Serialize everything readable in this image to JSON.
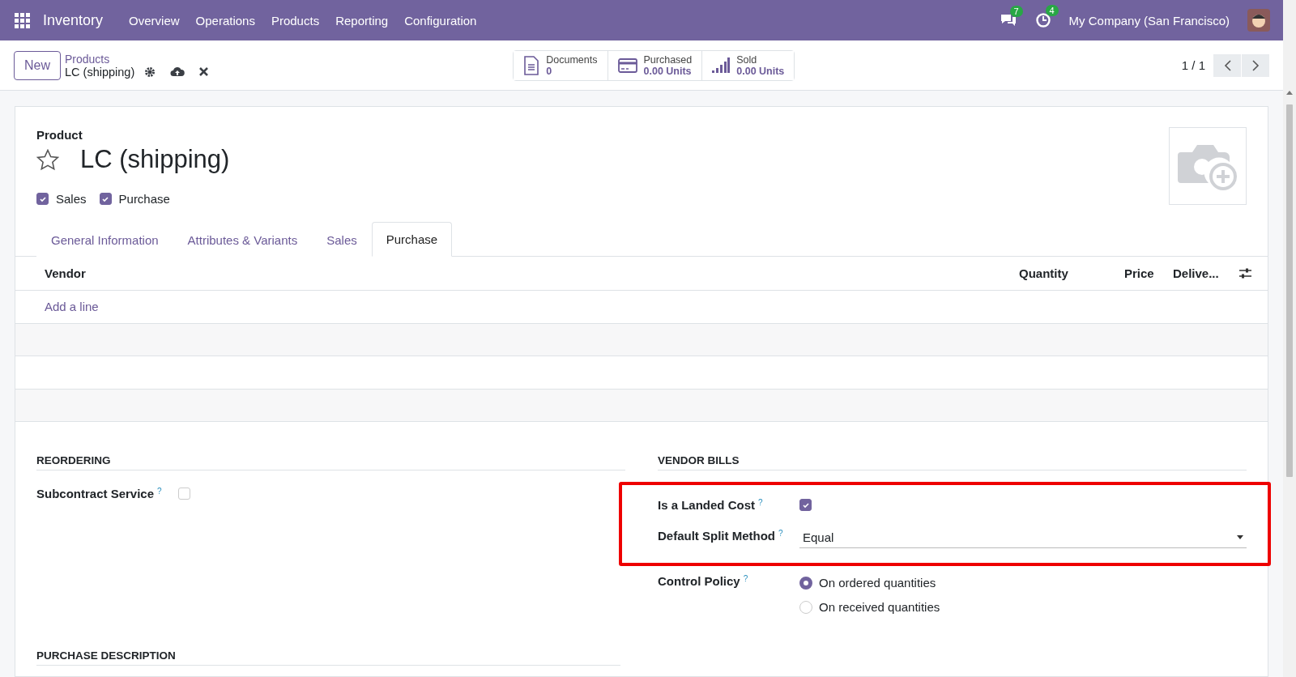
{
  "navbar": {
    "app_name": "Inventory",
    "menu": [
      "Overview",
      "Operations",
      "Products",
      "Reporting",
      "Configuration"
    ],
    "messages_count": "7",
    "activities_count": "4",
    "company": "My Company (San Francisco)"
  },
  "control_panel": {
    "new_button": "New",
    "breadcrumb_parent": "Products",
    "breadcrumb_current": "LC (shipping)",
    "stat_buttons": [
      {
        "kind": "document",
        "label": "Documents",
        "value": "0"
      },
      {
        "kind": "card",
        "label": "Purchased",
        "value": "0.00 Units"
      },
      {
        "kind": "bars",
        "label": "Sold",
        "value": "0.00 Units"
      }
    ],
    "pager": "1 / 1"
  },
  "form": {
    "label": "Product",
    "title": "LC (shipping)",
    "favorite": false,
    "options": [
      {
        "label": "Sales",
        "checked": true
      },
      {
        "label": "Purchase",
        "checked": true
      }
    ],
    "tabs": [
      {
        "label": "General Information",
        "selected": false
      },
      {
        "label": "Attributes & Variants",
        "selected": false
      },
      {
        "label": "Sales",
        "selected": false
      },
      {
        "label": "Purchase",
        "selected": true
      }
    ],
    "vendor_table": {
      "columns": [
        "Vendor",
        "Quantity",
        "Price",
        "Delive..."
      ],
      "add_line": "Add a line"
    },
    "reordering": {
      "heading": "REORDERING",
      "fields": [
        {
          "kind": "checkbox",
          "label": "Subcontract Service",
          "help": "?",
          "checked": false
        }
      ]
    },
    "vendor_bills": {
      "heading": "VENDOR BILLS",
      "highlighted_fields": [
        {
          "kind": "checkbox",
          "label": "Is a Landed Cost",
          "help": "?",
          "checked": true
        },
        {
          "kind": "select",
          "label": "Default Split Method",
          "help": "?",
          "value": "Equal"
        }
      ],
      "fields": [
        {
          "kind": "radio",
          "label": "Control Policy",
          "help": "?",
          "options": [
            {
              "label": "On ordered quantities",
              "selected": true
            },
            {
              "label": "On received quantities",
              "selected": false
            }
          ]
        }
      ]
    },
    "purchase_description": {
      "heading": "PURCHASE DESCRIPTION"
    }
  }
}
